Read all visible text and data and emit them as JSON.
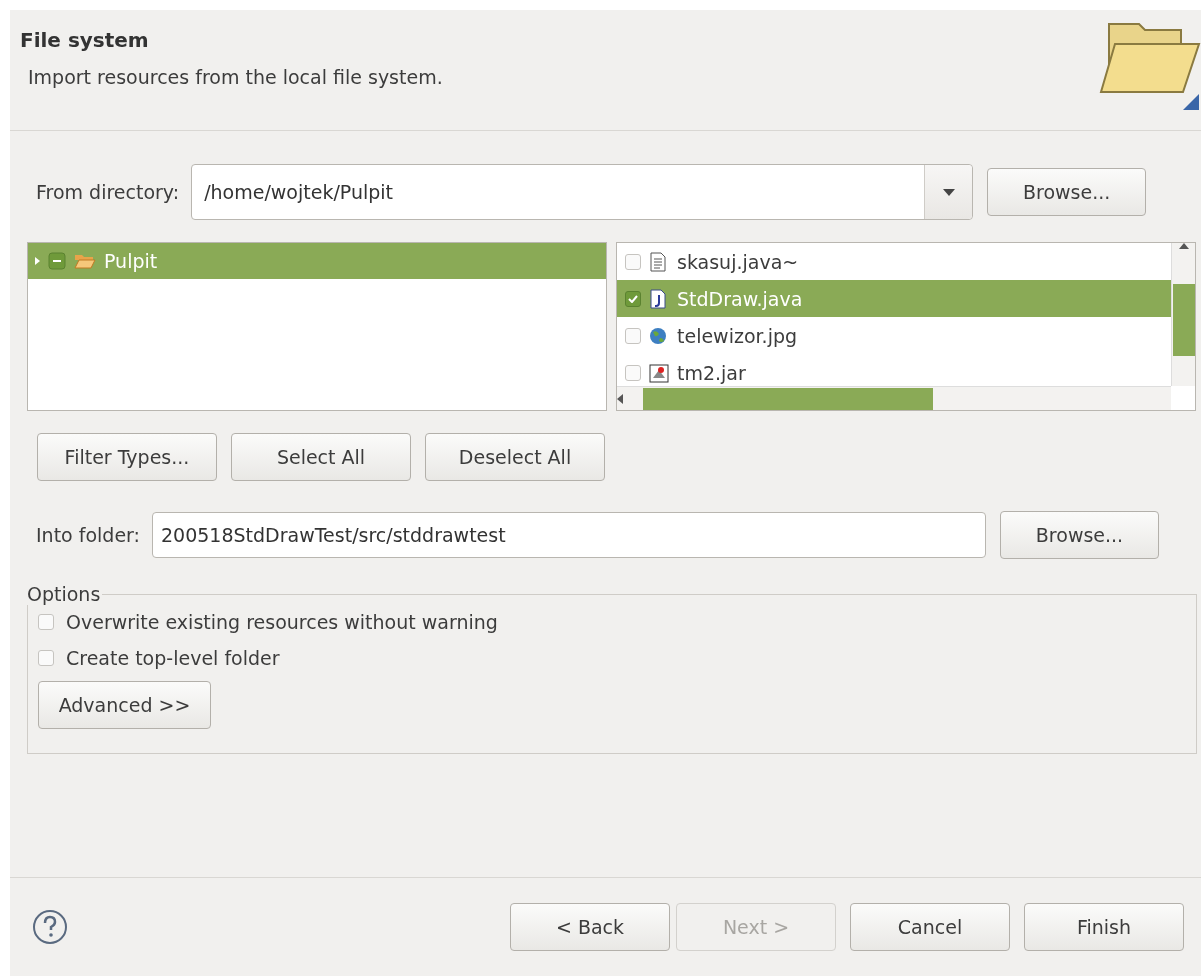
{
  "header": {
    "title": "File system",
    "description": "Import resources from the local file system."
  },
  "from_directory": {
    "label": "From directory:",
    "value": "/home/wojtek/Pulpit",
    "browse": "Browse..."
  },
  "folder_tree": [
    {
      "name": "Pulpit",
      "selected": true,
      "checked": true,
      "partial": true,
      "expanded": false
    }
  ],
  "files": [
    {
      "name": "skasuj.java~",
      "kind": "text",
      "checked": false,
      "selected": false
    },
    {
      "name": "StdDraw.java",
      "kind": "java",
      "checked": true,
      "selected": true
    },
    {
      "name": "telewizor.jpg",
      "kind": "image",
      "checked": false,
      "selected": false
    },
    {
      "name": "tm2.jar",
      "kind": "jar",
      "checked": false,
      "selected": false
    }
  ],
  "selection_buttons": [
    "Filter Types...",
    "Select All",
    "Deselect All"
  ],
  "into_folder": {
    "label": "Into folder:",
    "value": "200518StdDrawTest/src/stddrawtest",
    "browse": "Browse..."
  },
  "options": {
    "title": "Options",
    "checkboxes": [
      {
        "label": "Overwrite existing resources without warning",
        "checked": false
      },
      {
        "label": "Create top-level folder",
        "checked": false
      }
    ],
    "advanced": "Advanced >>"
  },
  "footer": {
    "buttons": [
      {
        "label": "< Back",
        "disabled": false
      },
      {
        "label": "Next >",
        "disabled": true
      },
      {
        "label": "Cancel",
        "disabled": false
      },
      {
        "label": "Finish",
        "disabled": false
      }
    ]
  }
}
